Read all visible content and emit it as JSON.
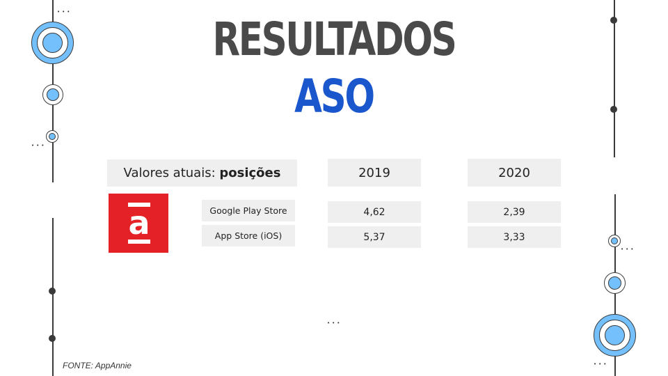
{
  "title": {
    "line1": "RESULTADOS",
    "line2": "ASO",
    "line1_color": "#4a4a4a",
    "line2_color": "#1a56cc"
  },
  "table": {
    "header_label_prefix": "Valores atuais: ",
    "header_label_bold": "posições",
    "years": [
      "2019",
      "2020"
    ],
    "logo_icon": "appannie-logo-icon",
    "logo_color": "#e42127",
    "rows": [
      {
        "store": "Google Play Store",
        "values": [
          "4,62",
          "2,39"
        ]
      },
      {
        "store": "App Store (iOS)",
        "values": [
          "5,37",
          "3,33"
        ]
      }
    ]
  },
  "source": "FONTE: AppAnnie",
  "decor": {
    "ellipsis": "•••",
    "accent_color": "#74c0fc"
  }
}
